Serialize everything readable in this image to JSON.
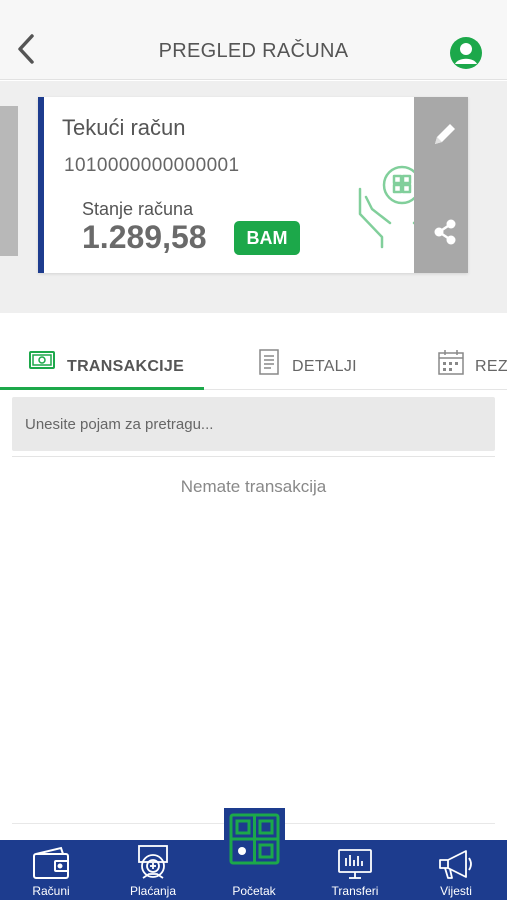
{
  "header": {
    "title": "PREGLED RAČUNA"
  },
  "account": {
    "name": "Tekući račun",
    "number": "1010000000000001",
    "balance_label": "Stanje računa",
    "balance": "1.289,58",
    "currency": "BAM"
  },
  "tabs": [
    {
      "label": "TRANSAKCIJE",
      "icon": "cash-icon",
      "active": true
    },
    {
      "label": "DETALJI",
      "icon": "document-icon",
      "active": false
    },
    {
      "label": "REZ",
      "icon": "calendar-icon",
      "active": false
    }
  ],
  "search": {
    "placeholder": "Unesite pojam za pretragu..."
  },
  "empty_message": "Nemate transakcija",
  "bottom_nav": [
    {
      "label": "Računi",
      "icon": "wallet-icon"
    },
    {
      "label": "Plaćanja",
      "icon": "payment-icon"
    },
    {
      "label": "Početak",
      "icon": "home-logo-icon"
    },
    {
      "label": "Transferi",
      "icon": "transfer-icon"
    },
    {
      "label": "Vijesti",
      "icon": "megaphone-icon"
    }
  ],
  "colors": {
    "brand_green": "#1ca84a",
    "brand_blue": "#1d3c8e"
  }
}
